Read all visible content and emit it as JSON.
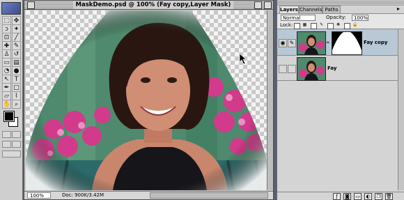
{
  "toolbox": {
    "tools": [
      {
        "icon": "marquee-icon",
        "glyph": "⬚"
      },
      {
        "icon": "move-icon",
        "glyph": "✥"
      },
      {
        "icon": "lasso-icon",
        "glyph": "ↄ"
      },
      {
        "icon": "magic-wand-icon",
        "glyph": "✦"
      },
      {
        "icon": "crop-icon",
        "glyph": "⊡"
      },
      {
        "icon": "slice-icon",
        "glyph": "╱"
      },
      {
        "icon": "healing-brush-icon",
        "glyph": "✚"
      },
      {
        "icon": "brush-icon",
        "glyph": "✎"
      },
      {
        "icon": "clone-stamp-icon",
        "glyph": "♙"
      },
      {
        "icon": "history-brush-icon",
        "glyph": "↺"
      },
      {
        "icon": "eraser-icon",
        "glyph": "▭"
      },
      {
        "icon": "gradient-icon",
        "glyph": "▤"
      },
      {
        "icon": "blur-icon",
        "glyph": "◔"
      },
      {
        "icon": "dodge-icon",
        "glyph": "●"
      },
      {
        "icon": "path-select-icon",
        "glyph": "↖"
      },
      {
        "icon": "type-icon",
        "glyph": "T"
      },
      {
        "icon": "pen-icon",
        "glyph": "✒"
      },
      {
        "icon": "shape-icon",
        "glyph": "□"
      },
      {
        "icon": "notes-icon",
        "glyph": "▱"
      },
      {
        "icon": "eyedropper-icon",
        "glyph": "⌇"
      },
      {
        "icon": "hand-icon",
        "glyph": "✋"
      },
      {
        "icon": "zoom-icon",
        "glyph": "⌕"
      }
    ]
  },
  "document": {
    "title": "MaskDemo.psd @ 100% (Fay copy,Layer Mask)",
    "zoom": "100%",
    "doc_info": "Doc: 900K/3.42M"
  },
  "layers_palette": {
    "tabs": [
      {
        "label": "Layers",
        "active": true
      },
      {
        "label": "Channels",
        "active": false
      },
      {
        "label": "Paths",
        "active": false
      }
    ],
    "blend_mode": "Normal",
    "opacity_label": "Opacity:",
    "opacity_value": "100%",
    "lock_label": "Lock:",
    "layers": [
      {
        "name": "Fay copy",
        "visible": true,
        "selected": true,
        "has_mask": true
      },
      {
        "name": "Fay",
        "visible": false,
        "selected": false,
        "has_mask": false
      }
    ],
    "bottom_buttons": [
      {
        "icon": "layer-style-icon",
        "glyph": "ƒ"
      },
      {
        "icon": "add-mask-icon",
        "glyph": "◙"
      },
      {
        "icon": "new-set-icon",
        "glyph": "▭"
      },
      {
        "icon": "adjustment-layer-icon",
        "glyph": "◐"
      },
      {
        "icon": "new-layer-icon",
        "glyph": "❐"
      },
      {
        "icon": "trash-icon",
        "glyph": "🗑"
      }
    ]
  },
  "colors": {
    "selected_layer_bg": "#b9c8d6",
    "accent_blue": "#3c4c8c"
  }
}
